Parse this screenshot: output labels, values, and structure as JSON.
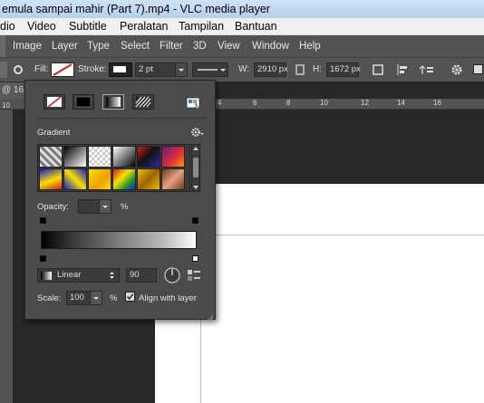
{
  "vlc": {
    "title": "emula sampai mahir (Part 7).mp4 - VLC media player",
    "menu": [
      "dio",
      "Video",
      "Subtitle",
      "Peralatan",
      "Tampilan",
      "Bantuan"
    ]
  },
  "photoshop": {
    "menu": [
      "Image",
      "Layer",
      "Type",
      "Select",
      "Filter",
      "3D",
      "View",
      "Window",
      "Help"
    ],
    "options": {
      "fill_label": "Fill:",
      "stroke_label": "Stroke:",
      "stroke_width": "2 pt",
      "w_label": "W:",
      "w_value": "2910 px",
      "h_label": "H:",
      "h_value": "1672 px"
    },
    "doc_tab": "@ 16.",
    "ruler_numbers": [
      "4",
      "6",
      "8",
      "10",
      "12",
      "14",
      "16"
    ],
    "ruler_left_numbers": [
      "10"
    ]
  },
  "panel": {
    "gradient_label": "Gradient",
    "opacity_label": "Opacity:",
    "opacity_value": "",
    "opacity_unit": "%",
    "style_value": "Linear",
    "angle_value": "90",
    "scale_label": "Scale:",
    "scale_value": "100",
    "scale_unit": "%",
    "align_label": "Align with layer",
    "align_checked": true
  },
  "colors": {
    "ps_bg": "#535353",
    "panel_bg": "#4b4b4b",
    "canvas": "#ffffff",
    "stroke_swatch": "#d22020"
  },
  "icons": [
    "settings-icon",
    "gear-icon",
    "chevron-down-icon",
    "angle-dial-icon",
    "reverse-gradient-icon",
    "swatches-picker-icon",
    "checkbox-icon"
  ]
}
